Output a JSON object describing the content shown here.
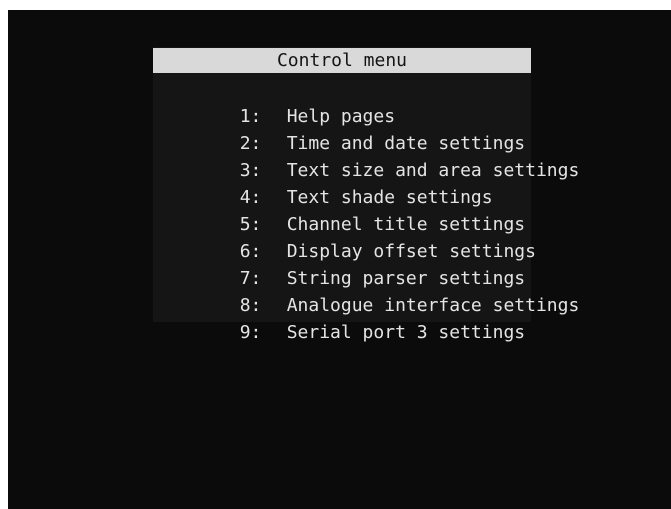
{
  "menu": {
    "title": "Control menu",
    "items": [
      {
        "number": "1:",
        "label": "Help pages"
      },
      {
        "number": "2:",
        "label": "Time and date settings"
      },
      {
        "number": "3:",
        "label": "Text size and area settings"
      },
      {
        "number": "4:",
        "label": "Text shade settings"
      },
      {
        "number": "5:",
        "label": "Channel title settings"
      },
      {
        "number": "6:",
        "label": "Display offset settings"
      },
      {
        "number": "7:",
        "label": "String parser settings"
      },
      {
        "number": "8:",
        "label": "Analogue interface settings"
      },
      {
        "number": "9:",
        "label": "Serial port 3 settings"
      }
    ]
  },
  "colors": {
    "screen_background": "#0b0b0b",
    "title_bar_background": "#d9d9d9",
    "title_text": "#141414",
    "menu_text": "#e4e4e4"
  }
}
